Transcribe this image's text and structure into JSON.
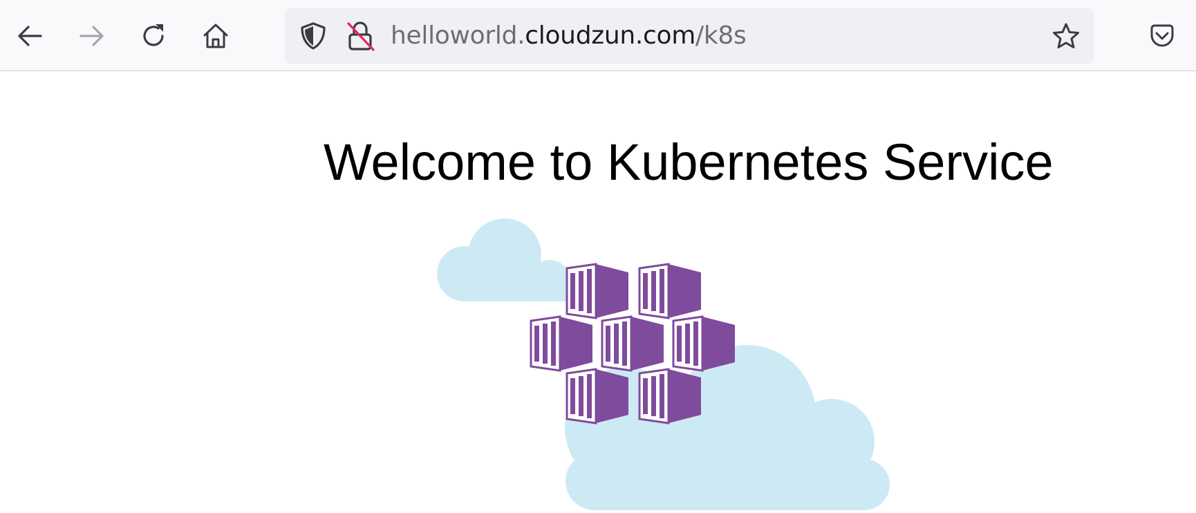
{
  "browser": {
    "url": {
      "prefix": "helloworld.",
      "domain": "cloudzun.com",
      "path": "/k8s"
    },
    "icons": {
      "back": "back-arrow-icon",
      "forward": "forward-arrow-icon",
      "reload": "reload-icon",
      "home": "home-icon",
      "tracking_protection": "shield-icon",
      "insecure": "insecure-lock-icon",
      "bookmark": "star-icon",
      "pocket": "pocket-icon"
    },
    "colors": {
      "toolbar_bg": "#f9f9fb",
      "urlbar_bg": "#f0f0f4",
      "insecure_strike": "#e22850"
    }
  },
  "page": {
    "title": "Welcome to Kubernetes Service",
    "logo": "azure-kubernetes-service-logo",
    "colors": {
      "cloud": "#cdeaf4",
      "container": "#7f4b9c"
    }
  }
}
